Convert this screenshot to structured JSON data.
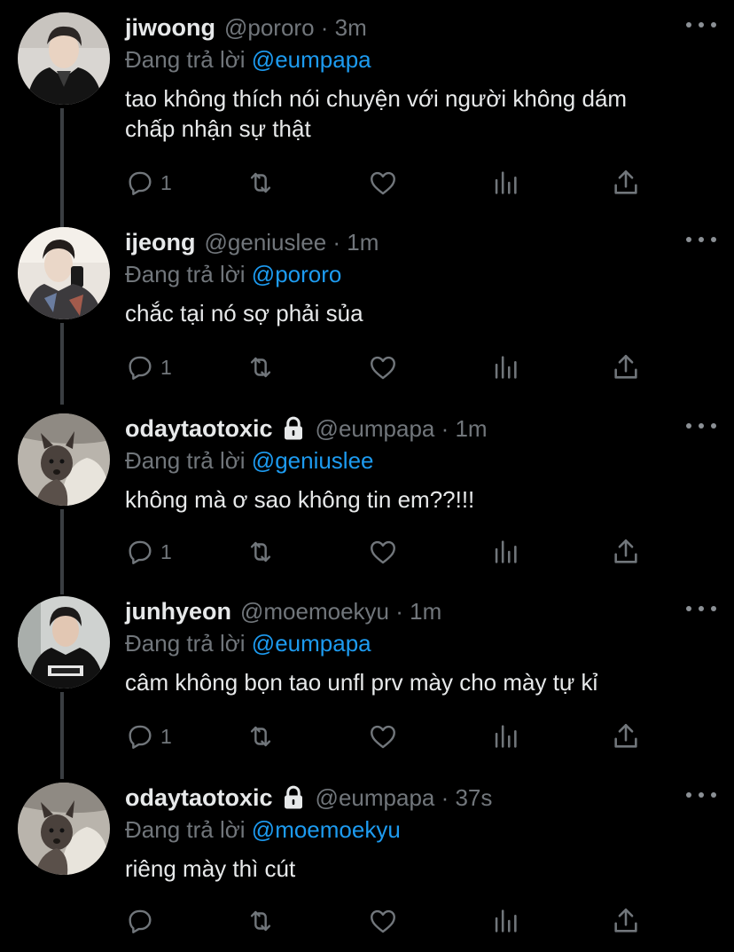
{
  "colors": {
    "background": "#000000",
    "text_primary": "#e7e9ea",
    "text_secondary": "#71767b",
    "link_blue": "#1d9bf0",
    "thread_line": "#3a3e42"
  },
  "reply_prefix": "Đang trả lời",
  "tweets": [
    {
      "name": "jiwoong",
      "handle": "@pororo",
      "time": "3m",
      "meta": "@pororo · 3m",
      "protected": false,
      "reply_to": "@eumpapa",
      "text": "tao không thích nói chuyện với người không dám\nchấp nhận sự thật",
      "reply_count": "1",
      "avatar": "avatar-person-black-jacket"
    },
    {
      "name": "ijeong",
      "handle": "@geniuslee",
      "time": "1m",
      "meta": "@geniuslee · 1m",
      "protected": false,
      "reply_to": "@pororo",
      "text": "chắc tại nó sợ phải sủa",
      "reply_count": "1",
      "avatar": "avatar-person-mirror-selfie"
    },
    {
      "name": "odaytaotoxic",
      "handle": "@eumpapa",
      "time": "1m",
      "meta": "@eumpapa · 1m",
      "protected": true,
      "reply_to": "@geniuslee",
      "text": "không mà ơ sao không tin em??!!!",
      "reply_count": "1",
      "avatar": "avatar-dog"
    },
    {
      "name": "junhyeon",
      "handle": "@moemoekyu",
      "time": "1m",
      "meta": "@moemoekyu · 1m",
      "protected": false,
      "reply_to": "@eumpapa",
      "text": "câm không bọn tao unfl prv mày cho mày tự kỉ",
      "reply_count": "1",
      "avatar": "avatar-person-dark-shirt"
    },
    {
      "name": "odaytaotoxic",
      "handle": "@eumpapa",
      "time": "37s",
      "meta": "@eumpapa · 37s",
      "protected": true,
      "reply_to": "@moemoekyu",
      "text": "riêng mày thì cút",
      "reply_count": "",
      "avatar": "avatar-dog"
    }
  ]
}
